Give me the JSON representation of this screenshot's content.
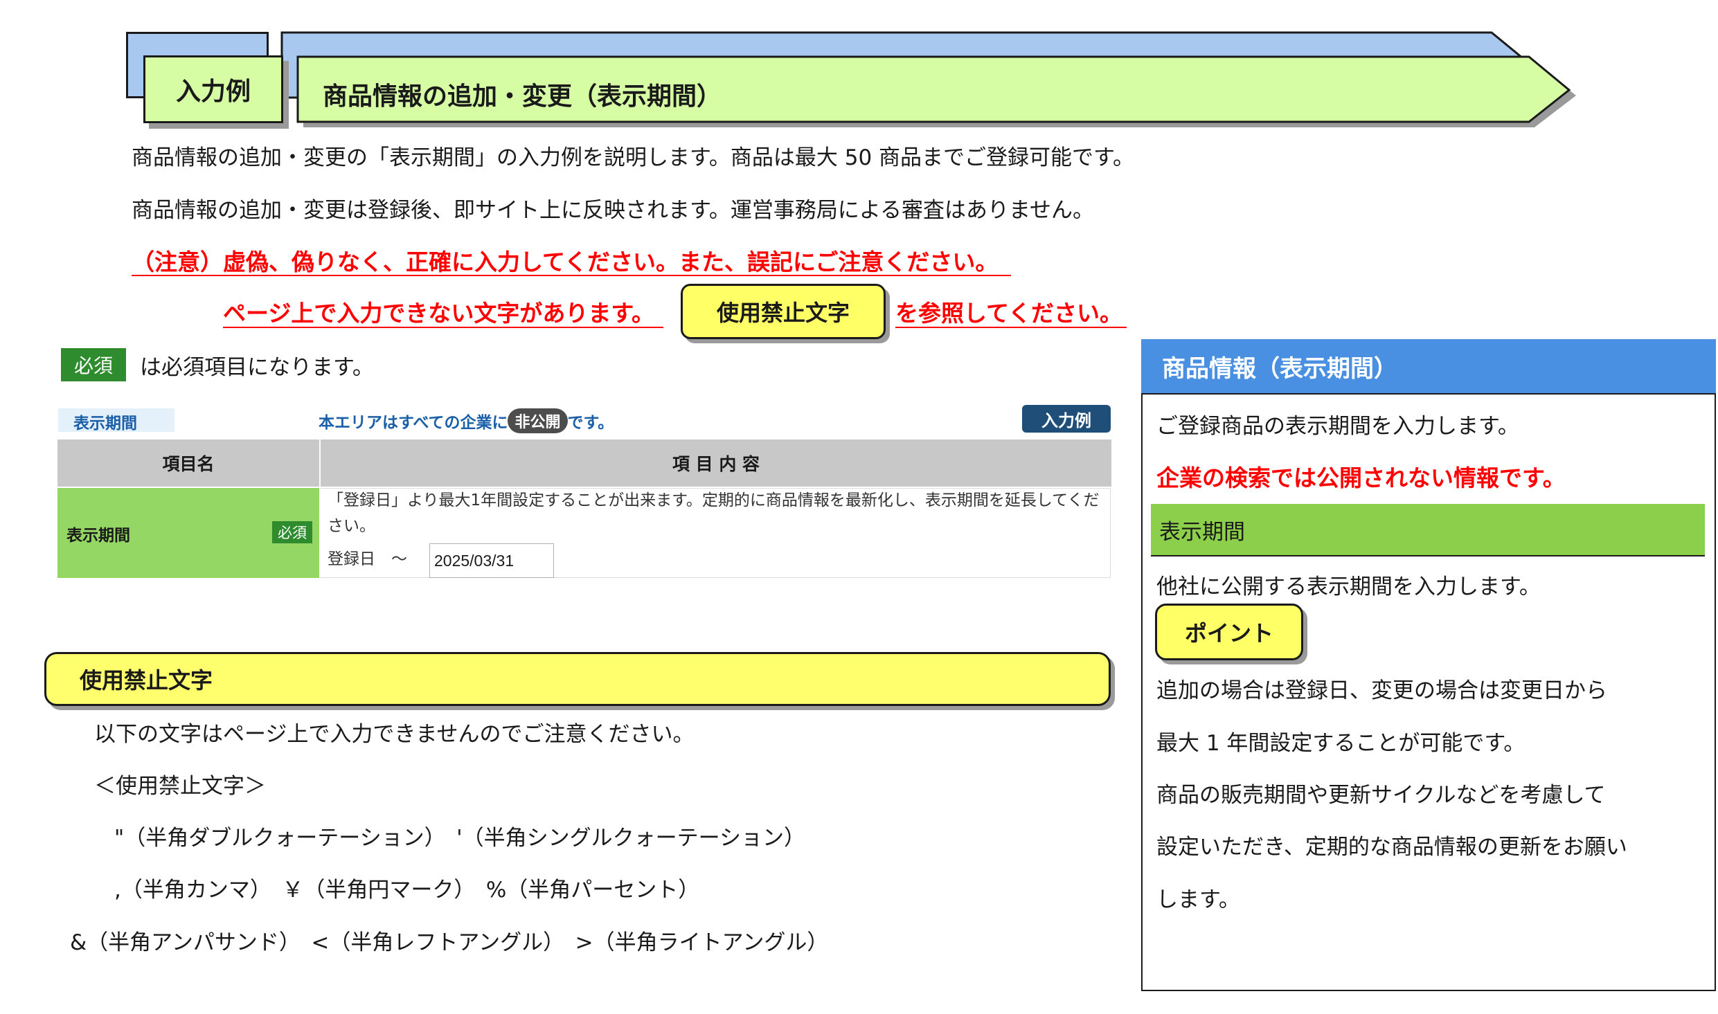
{
  "header": {
    "tab_label": "入力例",
    "title": "商品情報の追加・変更（表示期間）"
  },
  "intro": {
    "line1": "商品情報の追加・変更の「表示期間」の入力例を説明します。商品は最大 50 商品までご登録可能です。",
    "line2": "商品情報の追加・変更は登録後、即サイト上に反映されます。運営事務局による審査はありません。",
    "warning1": "（注意）虚偽、偽りなく、正確に入力してください。また、誤記にご注意ください。",
    "warning2_prefix": "ページ上で入力できない文字があります。",
    "forbidden_button": "使用禁止文字",
    "warning2_suffix": "を参照してください。"
  },
  "required_note": {
    "badge": "必須",
    "text": "は必須項目になります。"
  },
  "form": {
    "section_tag": "表示期間",
    "notice_prefix": "本エリアはすべての企業に",
    "notice_badge": "非公開",
    "notice_suffix": "です。",
    "example_button": "入力例",
    "col_name": "項目名",
    "col_content": "項 目 内 容",
    "row_label": "表示期間",
    "row_badge": "必須",
    "row_desc": "「登録日」より最大1年間設定することが出来ます。定期的に商品情報を最新化し、表示期間を延長してください。",
    "date_prefix": "登録日　～",
    "date_value": "2025/03/31"
  },
  "forbidden": {
    "title": "使用禁止文字",
    "intro": "以下の文字はページ上で入力できませんのでご注意ください。",
    "heading": "＜使用禁止文字＞",
    "line1": "\"（半角ダブルクォーテーション）　'（半角シングルクォーテーション）",
    "line2": ",（半角カンマ）　￥（半角円マーク）　%（半角パーセント）",
    "line3": "&（半角アンパサンド）　<（半角レフトアングル）　>（半角ライトアングル）"
  },
  "panel": {
    "title": "商品情報（表示期間）",
    "desc": "ご登録商品の表示期間を入力します。",
    "red_note": "企業の検索では公開されない情報です。",
    "field_name": "表示期間",
    "field_desc": "他社に公開する表示期間を入力します。",
    "point_label": "ポイント",
    "point_lines": [
      "追加の場合は登録日、変更の場合は変更日から",
      "最大 1 年間設定することが可能です。",
      "商品の販売期間や更新サイクルなどを考慮して",
      "設定いただき、定期的な商品情報の更新をお願い",
      "します。"
    ]
  },
  "colors": {
    "banner_green": "#d6fca4",
    "banner_blue": "#a8c8f0",
    "warning_red": "#ff0000",
    "panel_blue": "#4a90e2",
    "field_green": "#8ccf4a"
  }
}
